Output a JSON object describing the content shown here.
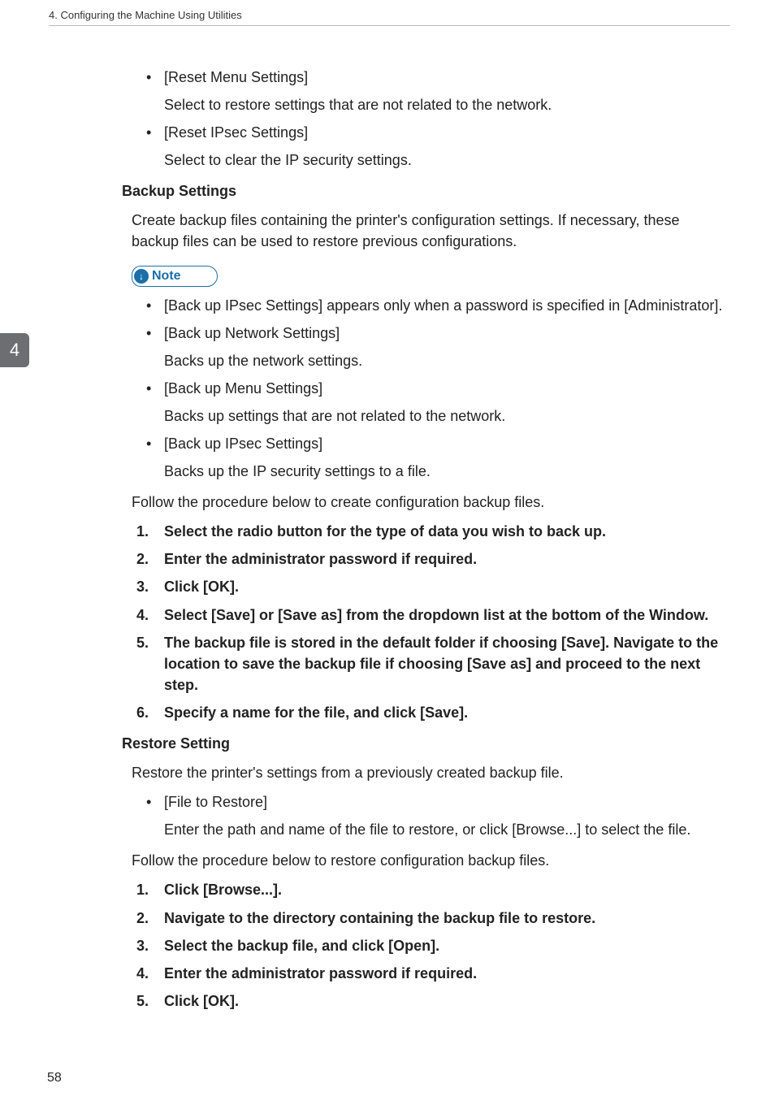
{
  "header": {
    "running": "4. Configuring the Machine Using Utilities"
  },
  "tab": "4",
  "folio": "58",
  "reset": {
    "menu": {
      "label": "[Reset Menu Settings]",
      "desc": "Select to restore settings that are not related to the network."
    },
    "ipsec": {
      "label": "[Reset IPsec Settings]",
      "desc": "Select to clear the IP security settings."
    }
  },
  "backup": {
    "heading": "Backup Settings",
    "intro": "Create backup files containing the printer's configuration settings. If necessary, these backup files can be used to restore previous configurations.",
    "note_label": "Note",
    "note_items": {
      "item1": "[Back up IPsec Settings] appears only when a password is specified in [Administrator]."
    },
    "items": {
      "network": {
        "label": "[Back up Network Settings]",
        "desc": "Backs up the network settings."
      },
      "menu": {
        "label": "[Back up Menu Settings]",
        "desc": "Backs up settings that are not related to the network."
      },
      "ipsec": {
        "label": "[Back up IPsec Settings]",
        "desc": "Backs up the IP security settings to a file."
      }
    },
    "follow": "Follow the procedure below to create configuration backup files.",
    "steps": {
      "s1": "Select the radio button for the type of data you wish to back up.",
      "s2": "Enter the administrator password if required.",
      "s3": "Click [OK].",
      "s4": "Select [Save] or [Save as] from the dropdown list at the bottom of the Window.",
      "s5": "The backup file is stored in the default folder if choosing [Save]. Navigate to the location to save the backup file if choosing [Save as] and proceed to the next step.",
      "s6": "Specify a name for the file, and click [Save]."
    }
  },
  "restore": {
    "heading": "Restore Setting",
    "intro": "Restore the printer's settings from a previously created backup file.",
    "file": {
      "label": "[File to Restore]",
      "desc": "Enter the path and name of the file to restore, or click [Browse...] to select the file."
    },
    "follow": "Follow the procedure below to restore configuration backup files.",
    "steps": {
      "s1": "Click [Browse...].",
      "s2": "Navigate to the directory containing the backup file to restore.",
      "s3": "Select the backup file, and click [Open].",
      "s4": "Enter the administrator password if required.",
      "s5": "Click [OK]."
    }
  }
}
